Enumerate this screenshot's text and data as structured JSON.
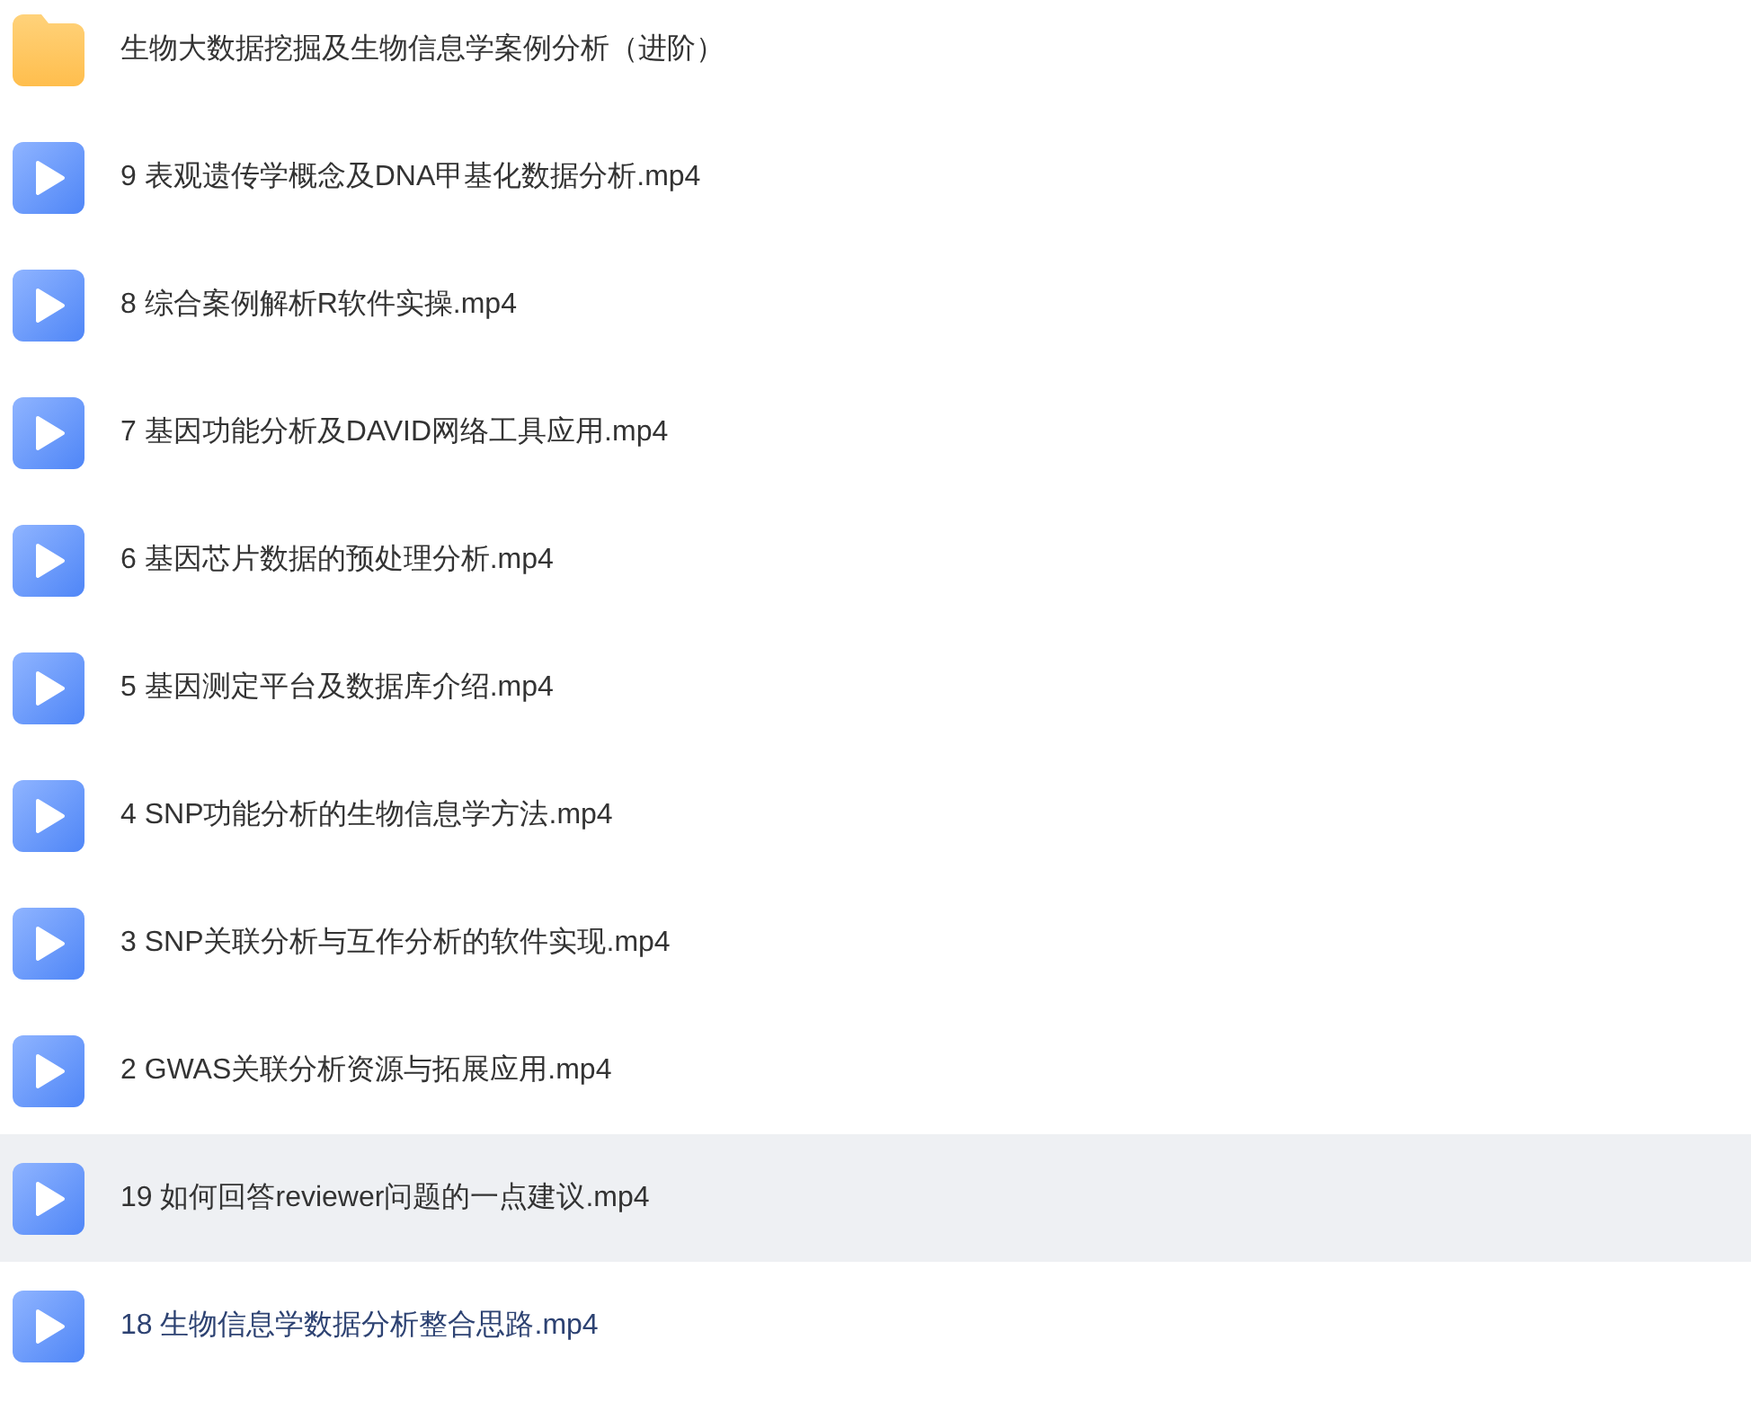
{
  "files": [
    {
      "kind": "folder",
      "name": "生物大数据挖掘及生物信息学案例分析（进阶）",
      "hovered": false,
      "selected": false
    },
    {
      "kind": "video",
      "name": "9 表观遗传学概念及DNA甲基化数据分析.mp4",
      "hovered": false,
      "selected": false
    },
    {
      "kind": "video",
      "name": "8 综合案例解析R软件实操.mp4",
      "hovered": false,
      "selected": false
    },
    {
      "kind": "video",
      "name": "7 基因功能分析及DAVID网络工具应用.mp4",
      "hovered": false,
      "selected": false
    },
    {
      "kind": "video",
      "name": "6 基因芯片数据的预处理分析.mp4",
      "hovered": false,
      "selected": false
    },
    {
      "kind": "video",
      "name": "5 基因测定平台及数据库介绍.mp4",
      "hovered": false,
      "selected": false
    },
    {
      "kind": "video",
      "name": "4 SNP功能分析的生物信息学方法.mp4",
      "hovered": false,
      "selected": false
    },
    {
      "kind": "video",
      "name": "3 SNP关联分析与互作分析的软件实现.mp4",
      "hovered": false,
      "selected": false
    },
    {
      "kind": "video",
      "name": "2 GWAS关联分析资源与拓展应用.mp4",
      "hovered": false,
      "selected": false
    },
    {
      "kind": "video",
      "name": "19 如何回答reviewer问题的一点建议.mp4",
      "hovered": true,
      "selected": false
    },
    {
      "kind": "video",
      "name": "18 生物信息学数据分析整合思路.mp4",
      "hovered": false,
      "selected": true
    }
  ]
}
